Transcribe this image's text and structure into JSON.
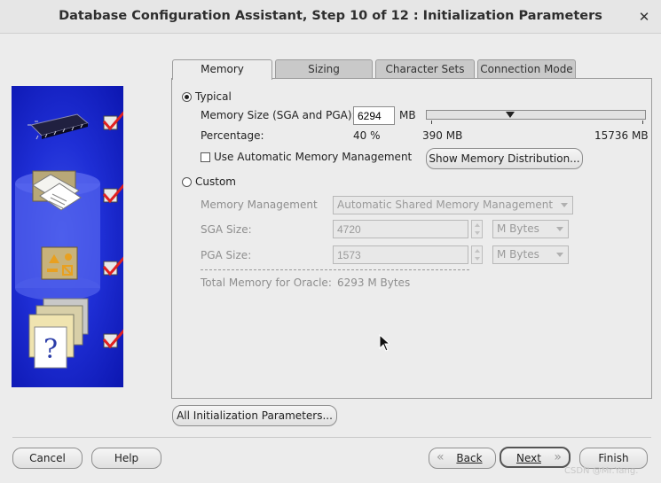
{
  "window": {
    "title": "Database Configuration Assistant, Step 10 of 12 : Initialization Parameters"
  },
  "tabs": [
    "Memory",
    "Sizing",
    "Character Sets",
    "Connection Mode"
  ],
  "memory": {
    "typical_label": "Typical",
    "memory_size_label": "Memory Size (SGA and PGA):",
    "memory_size_value": "6294",
    "memory_size_unit": "MB",
    "percentage_label": "Percentage:",
    "percentage_value": "40 %",
    "slider_min": "390 MB",
    "slider_max": "15736 MB",
    "slider_level": 0.4,
    "use_amm_label": "Use Automatic Memory Management",
    "use_amm_checked": false,
    "show_distribution_button": "Show Memory Distribution...",
    "custom_label": "Custom",
    "memory_management_label": "Memory Management",
    "memory_management_value": "Automatic Shared Memory Management",
    "sga_size_label": "SGA Size:",
    "sga_size_value": "4720",
    "sga_unit": "M Bytes",
    "pga_size_label": "PGA Size:",
    "pga_size_value": "1573",
    "pga_unit": "M Bytes",
    "total_memory_label": "Total Memory for Oracle:",
    "total_memory_value": "6293 M Bytes"
  },
  "buttons": {
    "all_params": "All Initialization Parameters...",
    "cancel": "Cancel",
    "help": "Help",
    "back": "Back",
    "next": "Next",
    "finish": "Finish"
  },
  "watermark": "CSDN @Mr.Yang."
}
